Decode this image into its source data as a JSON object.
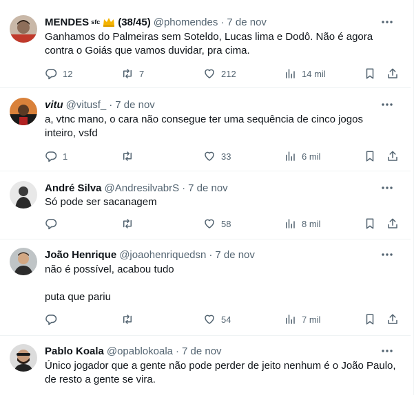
{
  "tweets": [
    {
      "name": "MENDES",
      "name_sup": "sfc",
      "name_suffix": "(38/45)",
      "handle": "@phomendes",
      "time": "7 de nov",
      "text": [
        "Ganhamos do Palmeiras sem Soteldo, Lucas lima e Dodô. Não é agora contra o Goiás que vamos duvidar, pra cima."
      ],
      "replies": "12",
      "retweets": "7",
      "likes": "212",
      "views": "14 mil"
    },
    {
      "name": "vitu",
      "handle": "@vitusf_",
      "time": "7 de nov",
      "text": [
        "a, vtnc mano, o cara não consegue ter uma sequência de cinco jogos inteiro, vsfd"
      ],
      "replies": "1",
      "retweets": "",
      "likes": "33",
      "views": "6 mil"
    },
    {
      "name": "André Silva",
      "handle": "@AndresilvabrS",
      "time": "7 de nov",
      "text": [
        "Só pode ser sacanagem"
      ],
      "replies": "",
      "retweets": "",
      "likes": "58",
      "views": "8 mil"
    },
    {
      "name": "João Henrique",
      "handle": "@joaohenriquedsn",
      "time": "7 de nov",
      "text": [
        "não é possível, acabou tudo",
        "puta que pariu"
      ],
      "replies": "",
      "retweets": "",
      "likes": "54",
      "views": "7 mil"
    },
    {
      "name": "Pablo Koala",
      "handle": "@opablokoala",
      "time": "7 de nov",
      "text": [
        "Único jogador que a gente não pode perder de jeito nenhum é o João Paulo, de resto a gente se vira."
      ]
    }
  ],
  "separator": "·",
  "colors": {
    "text": "#0f1419",
    "secondary": "#536471",
    "border": "#eff3f4",
    "crown": "#f5b400"
  },
  "icons": [
    "reply-icon",
    "retweet-icon",
    "like-icon",
    "views-icon",
    "bookmark-icon",
    "share-icon",
    "more-icon",
    "crown-icon"
  ]
}
